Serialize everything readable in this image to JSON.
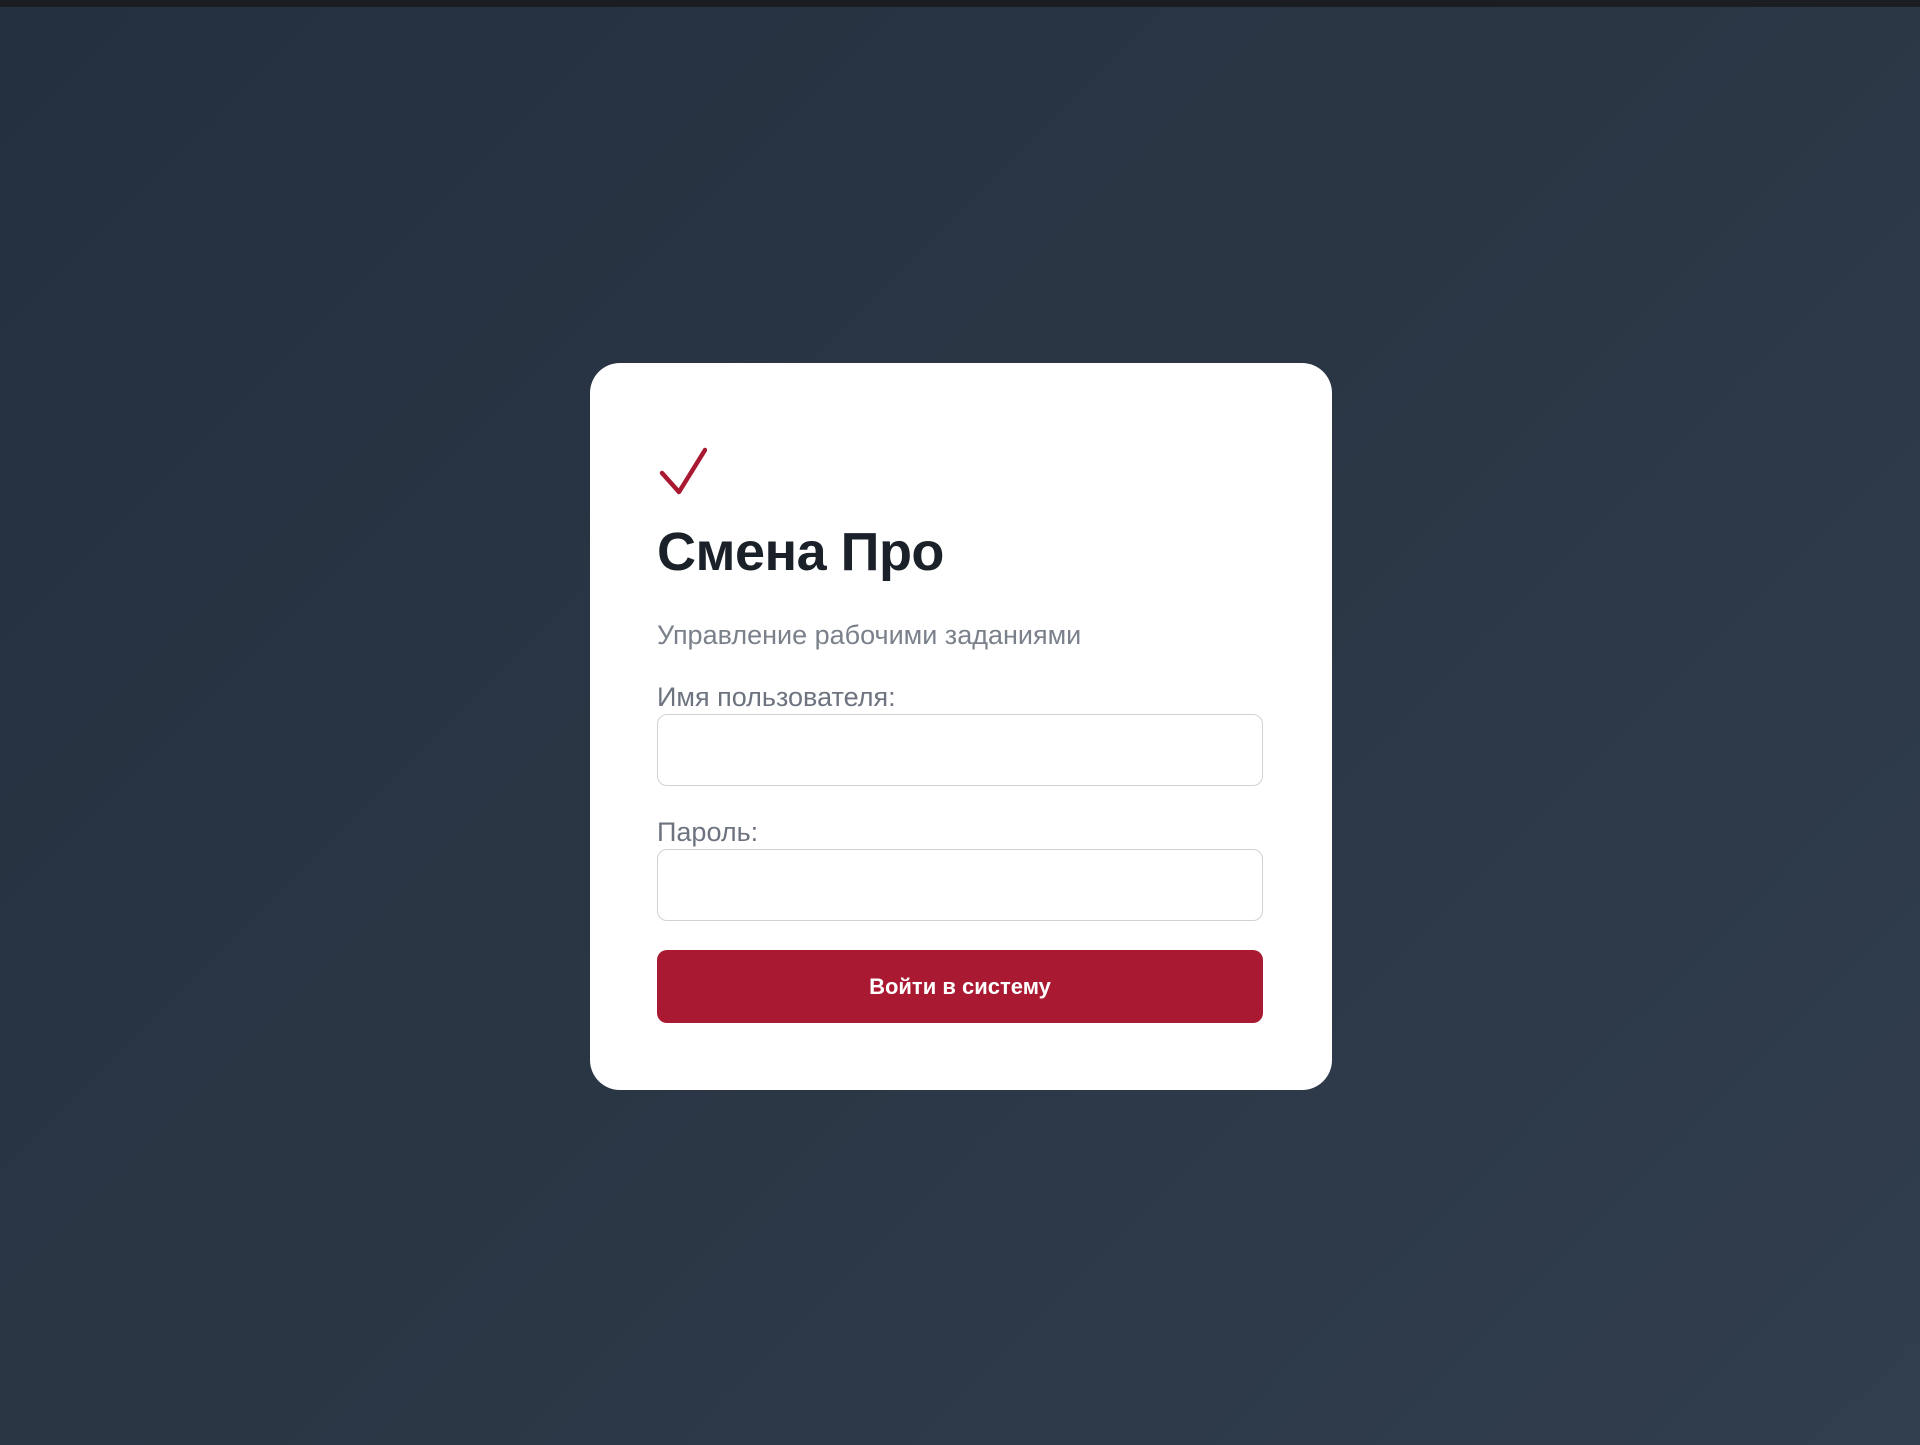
{
  "app": {
    "logo_icon": "checkmark-icon",
    "title": "Смена Про",
    "subtitle": "Управление рабочими заданиями"
  },
  "login_form": {
    "username": {
      "label": "Имя пользователя:",
      "value": "",
      "placeholder": ""
    },
    "password": {
      "label": "Пароль:",
      "value": "",
      "placeholder": ""
    },
    "submit_label": "Войти в систему"
  },
  "colors": {
    "accent": "#a91a32",
    "background": "#2b3645",
    "card": "#ffffff",
    "title_text": "#1b2129",
    "muted_text": "#7a818b"
  }
}
